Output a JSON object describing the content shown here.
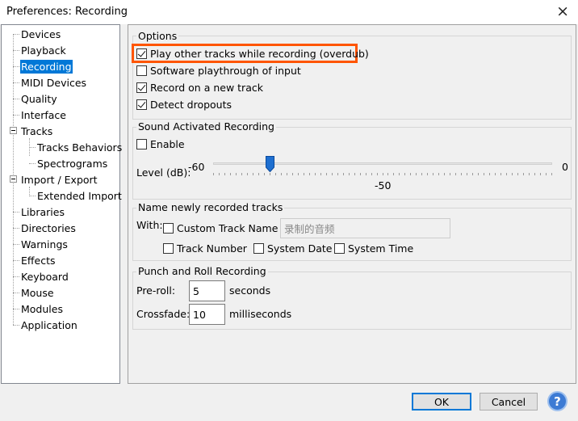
{
  "window": {
    "title": "Preferences: Recording",
    "close_icon": "×"
  },
  "tree": {
    "items": [
      {
        "label": "Devices"
      },
      {
        "label": "Playback"
      },
      {
        "label": "Recording",
        "selected": true
      },
      {
        "label": "MIDI Devices"
      },
      {
        "label": "Quality"
      },
      {
        "label": "Interface"
      },
      {
        "label": "Tracks",
        "expander": "⊟"
      },
      {
        "label": "Tracks Behaviors"
      },
      {
        "label": "Spectrograms"
      },
      {
        "label": "Import / Export",
        "expander": "⊟"
      },
      {
        "label": "Extended Import"
      },
      {
        "label": "Libraries"
      },
      {
        "label": "Directories"
      },
      {
        "label": "Warnings"
      },
      {
        "label": "Effects"
      },
      {
        "label": "Keyboard"
      },
      {
        "label": "Mouse"
      },
      {
        "label": "Modules"
      },
      {
        "label": "Application"
      }
    ]
  },
  "options": {
    "title": "Options",
    "play_other_tracks": {
      "label": "Play other tracks while recording (overdub)",
      "checked": true
    },
    "software_playthrough": {
      "label": "Software playthrough of input",
      "checked": false
    },
    "record_new_track": {
      "label": "Record on a new track",
      "checked": true
    },
    "detect_dropouts": {
      "label": "Detect dropouts",
      "checked": true
    }
  },
  "sound_activated": {
    "title": "Sound Activated Recording",
    "enable": {
      "label": "Enable",
      "checked": false
    },
    "level_label": "Level (dB):",
    "min_label": "-60",
    "max_label": "0",
    "value_label": "-50",
    "value": -50,
    "min": -60,
    "max": 0
  },
  "naming": {
    "title": "Name newly recorded tracks",
    "with_label": "With:",
    "custom_track_name": {
      "label": "Custom Track Name",
      "checked": false
    },
    "custom_name_value": "录制的音频",
    "track_number": {
      "label": "Track Number",
      "checked": false
    },
    "system_date": {
      "label": "System Date",
      "checked": false
    },
    "system_time": {
      "label": "System Time",
      "checked": false
    }
  },
  "punch_roll": {
    "title": "Punch and Roll Recording",
    "preroll_label": "Pre-roll:",
    "preroll_value": "5",
    "preroll_unit": "seconds",
    "crossfade_label": "Crossfade:",
    "crossfade_value": "10",
    "crossfade_unit": "milliseconds"
  },
  "buttons": {
    "ok": "OK",
    "cancel": "Cancel",
    "help_icon": "?"
  },
  "colors": {
    "highlight": "#ff5500",
    "selection": "#0078d7",
    "slider_thumb": "#1e6fd0"
  }
}
